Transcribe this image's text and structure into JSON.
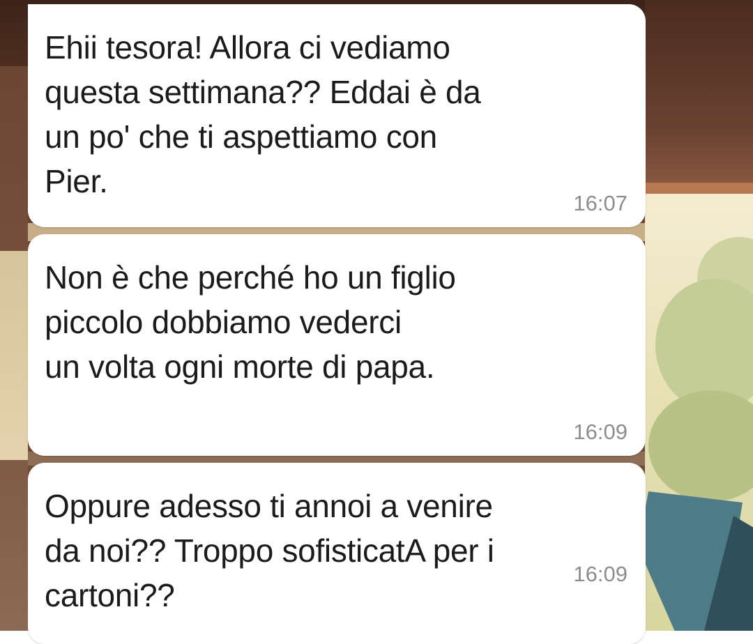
{
  "messages": [
    {
      "text": "Ehii tesora! Allora ci vediamo\nquesta settimana?? Eddai è da\nun po' che ti aspettiamo con\nPier.",
      "time": "16:07"
    },
    {
      "text": "Non è che perché ho un figlio\npiccolo dobbiamo vederci\nun volta ogni morte di papa.",
      "time": "16:09"
    },
    {
      "text": "Oppure adesso ti annoi a venire\nda noi?? Troppo sofisticatA per i\ncartoni??",
      "time": "16:09"
    }
  ],
  "colors": {
    "bubble": "#ffffff",
    "text": "#1b1b1b",
    "timestamp": "#8d8d8d"
  }
}
